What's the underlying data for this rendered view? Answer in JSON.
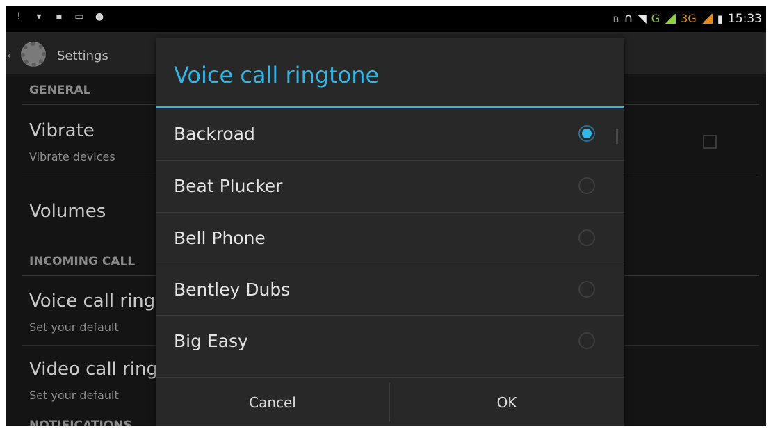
{
  "status_bar": {
    "left_icons": [
      "alert-icon",
      "wifi-icon",
      "lock-icon",
      "screenshot-icon",
      "android-icon"
    ],
    "network_g": "G",
    "network_3g": "3G",
    "time": "15:33"
  },
  "action_bar": {
    "title": "Settings"
  },
  "settings": {
    "general_header": "GENERAL",
    "vibrate_title": "Vibrate",
    "vibrate_sub": "Vibrate devices",
    "volumes_title": "Volumes",
    "incoming_header": "INCOMING CALL",
    "voice_title": "Voice call ringtone",
    "voice_sub": "Set your default",
    "video_title": "Video call ringtone",
    "video_sub": "Set your default",
    "notifications_header": "NOTIFICATIONS"
  },
  "dialog": {
    "title": "Voice call ringtone",
    "options": [
      {
        "label": "Backroad",
        "selected": true
      },
      {
        "label": "Beat Plucker",
        "selected": false
      },
      {
        "label": "Bell Phone",
        "selected": false
      },
      {
        "label": "Bentley Dubs",
        "selected": false
      },
      {
        "label": "Big Easy",
        "selected": false
      }
    ],
    "cancel_label": "Cancel",
    "ok_label": "OK"
  },
  "colors": {
    "accent": "#33b5e5",
    "network_green": "#8ccf3f",
    "network_orange": "#e48b1e"
  }
}
